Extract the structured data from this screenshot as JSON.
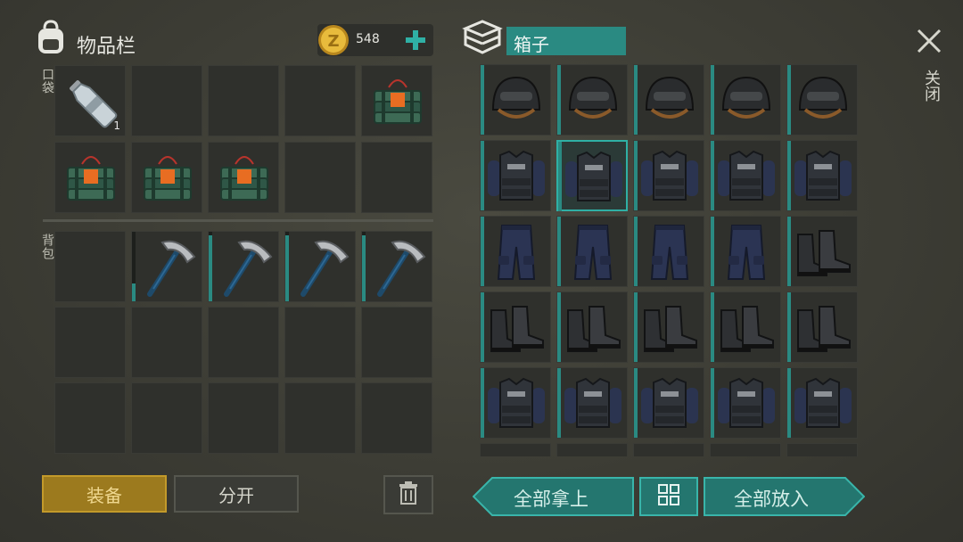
{
  "inventory": {
    "title": "物品栏",
    "pocket_label": "口袋",
    "backpack_label": "背包",
    "coins": "548",
    "pocket_slots": [
      {
        "item": "water-bottle",
        "qty": "1"
      },
      {
        "item": ""
      },
      {
        "item": ""
      },
      {
        "item": ""
      },
      {
        "item": "c4-explosive"
      },
      {
        "item": "c4-explosive"
      },
      {
        "item": "c4-explosive"
      },
      {
        "item": "c4-explosive"
      },
      {
        "item": ""
      },
      {
        "item": ""
      }
    ],
    "backpack_slots": [
      {
        "item": ""
      },
      {
        "item": "pickaxe",
        "durability": 0.25
      },
      {
        "item": "pickaxe",
        "durability": 0.95
      },
      {
        "item": "pickaxe",
        "durability": 0.95
      },
      {
        "item": "pickaxe",
        "durability": 0.95
      },
      {
        "item": ""
      },
      {
        "item": ""
      },
      {
        "item": ""
      },
      {
        "item": ""
      },
      {
        "item": ""
      },
      {
        "item": ""
      },
      {
        "item": ""
      },
      {
        "item": ""
      },
      {
        "item": ""
      },
      {
        "item": ""
      }
    ],
    "equip_label": "装备",
    "split_label": "分开"
  },
  "box": {
    "title": "箱子",
    "rows": [
      [
        "police-helmet",
        "police-helmet",
        "police-helmet",
        "police-helmet",
        "police-helmet"
      ],
      [
        "police-vest",
        "police-vest",
        "police-vest",
        "police-vest",
        "police-vest"
      ],
      [
        "police-pants",
        "police-pants",
        "police-pants",
        "police-pants",
        "combat-boots"
      ],
      [
        "combat-boots",
        "combat-boots",
        "combat-boots",
        "combat-boots",
        "combat-boots"
      ],
      [
        "police-vest",
        "police-vest",
        "police-vest",
        "police-vest",
        "police-vest"
      ]
    ],
    "selected": [
      1,
      1
    ],
    "take_all_label": "全部拿上",
    "put_all_label": "全部放入"
  },
  "close_label": "关闭",
  "colors": {
    "accent": "#2a8a82",
    "equip": "#c39a2a",
    "coin": "#e0b43a"
  }
}
